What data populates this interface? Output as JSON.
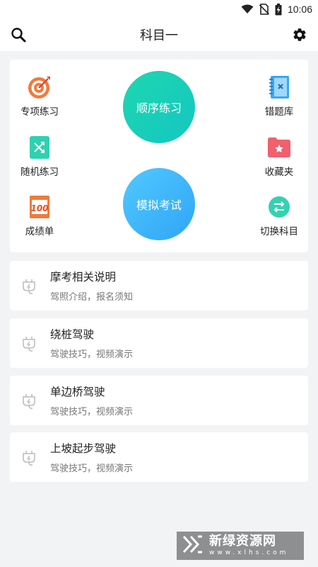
{
  "status_bar": {
    "time": "10:06"
  },
  "header": {
    "title": "科目一"
  },
  "features": {
    "special": {
      "label": "专项练习",
      "icon": "target-icon"
    },
    "random": {
      "label": "随机练习",
      "icon": "shuffle-icon"
    },
    "scores": {
      "label": "成绩单",
      "icon": "score-100-icon"
    },
    "mistakes": {
      "label": "错题库",
      "icon": "notebook-x-icon"
    },
    "favorites": {
      "label": "收藏夹",
      "icon": "folder-star-icon"
    },
    "switch_subject": {
      "label": "切换科目",
      "icon": "swap-icon"
    },
    "sequential": {
      "label": "顺序练习"
    },
    "mock_exam": {
      "label": "模拟考试"
    }
  },
  "colors": {
    "practice": "#13c7c1",
    "exam": "#2ea6f5",
    "accent_orange": "#f07a3c",
    "accent_red": "#f0606d"
  },
  "list": [
    {
      "title": "摩考相关说明",
      "subtitle": "驾照介绍，报名须知"
    },
    {
      "title": "绕桩驾驶",
      "subtitle": "驾驶技巧，视频演示"
    },
    {
      "title": "单边桥驾驶",
      "subtitle": "驾驶技巧，视频演示"
    },
    {
      "title": "上坡起步驾驶",
      "subtitle": "驾驶技巧，视频演示"
    }
  ],
  "watermark": {
    "name": "新绿资源网",
    "url": "www.xlhs.com"
  }
}
